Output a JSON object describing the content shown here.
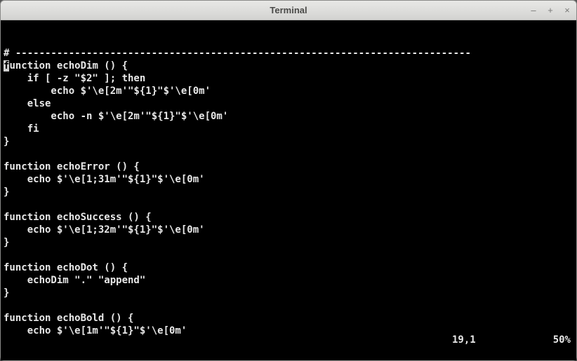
{
  "window": {
    "title": "Terminal"
  },
  "terminal": {
    "lines": [
      "# -----------------------------------------------------------------------------",
      "function echoDim () {",
      "    if [ -z \"$2\" ]; then",
      "        echo $'\\e[2m'\"${1}\"$'\\e[0m'",
      "    else",
      "        echo -n $'\\e[2m'\"${1}\"$'\\e[0m'",
      "    fi",
      "}",
      "",
      "function echoError () {",
      "    echo $'\\e[1;31m'\"${1}\"$'\\e[0m'",
      "}",
      "",
      "function echoSuccess () {",
      "    echo $'\\e[1;32m'\"${1}\"$'\\e[0m'",
      "}",
      "",
      "function echoDot () {",
      "    echoDim \".\" \"append\"",
      "}",
      "",
      "function echoBold () {",
      "    echo $'\\e[1m'\"${1}\"$'\\e[0m'"
    ],
    "cursor": {
      "line": 1,
      "col": 0
    },
    "status": {
      "position": "19,1",
      "percent": "50%"
    }
  }
}
